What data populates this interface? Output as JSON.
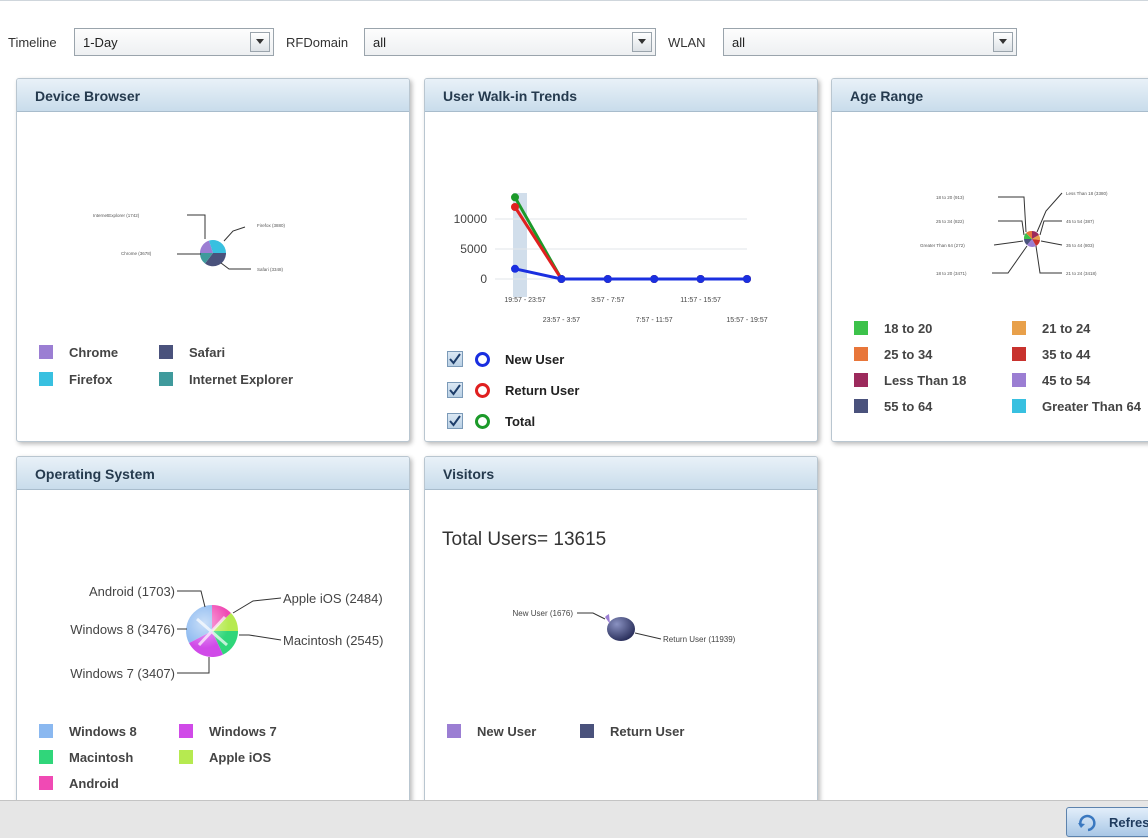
{
  "filters": {
    "timeline": {
      "label": "Timeline",
      "value": "1-Day"
    },
    "rfdomain": {
      "label": "RFDomain",
      "value": "all"
    },
    "wlan": {
      "label": "WLAN",
      "value": "all"
    }
  },
  "panels": {
    "device_browser": {
      "title": "Device Browser",
      "callouts": [
        "InternetExplorer (1742)",
        "Firefox (3880)",
        "Chrome (3678)",
        "Safari (3348)"
      ],
      "legend": [
        {
          "label": "Chrome",
          "color": "#9b7ed3"
        },
        {
          "label": "Safari",
          "color": "#4a527c"
        },
        {
          "label": "Firefox",
          "color": "#38c0e0"
        },
        {
          "label": "Internet Explorer",
          "color": "#3f9a9c"
        }
      ]
    },
    "user_walkin": {
      "title": "User Walk-in Trends",
      "chart_data": {
        "type": "line",
        "x": [
          "19:57 - 23:57",
          "23:57 - 3:57",
          "3:57 - 7:57",
          "7:57 - 11:57",
          "11:57 - 15:57",
          "15:57 - 19:57"
        ],
        "yticks": [
          "10000",
          "5000",
          "0"
        ],
        "ylim": [
          0,
          15000
        ],
        "series": [
          {
            "name": "New User",
            "color": "#1a2fe0",
            "values": [
              1700,
              0,
              0,
              0,
              0,
              0
            ]
          },
          {
            "name": "Return User",
            "color": "#e02020",
            "values": [
              12000,
              0,
              0,
              0,
              0,
              0
            ]
          },
          {
            "name": "Total",
            "color": "#1c9a2a",
            "values": [
              13615,
              0,
              0,
              0,
              0,
              0
            ]
          }
        ]
      },
      "legend": [
        {
          "label": "New User",
          "color": "#1a2fe0",
          "checked": true
        },
        {
          "label": "Return User",
          "color": "#e02020",
          "checked": true
        },
        {
          "label": "Total",
          "color": "#1c9a2a",
          "checked": true
        }
      ]
    },
    "age_range": {
      "title": "Age Range",
      "callouts": [
        "18 to 20 (913)",
        "Less Than 18 (3380)",
        "25 to 34 (822)",
        "45 to 54 (387)",
        "Greater Than 64 (272)",
        "35 to 44 (803)",
        "18 to 20 (3471)",
        "21 to 24 (3418)"
      ],
      "legend": [
        {
          "label": "18 to 20",
          "color": "#3cc24a"
        },
        {
          "label": "21 to 24",
          "color": "#e8a04a"
        },
        {
          "label": "25 to 34",
          "color": "#e8763a"
        },
        {
          "label": "35 to 44",
          "color": "#c8322e"
        },
        {
          "label": "Less Than 18",
          "color": "#9c2a5c"
        },
        {
          "label": "45 to 54",
          "color": "#9b7ed3"
        },
        {
          "label": "55 to 64",
          "color": "#4a527c"
        },
        {
          "label": "Greater Than 64",
          "color": "#38c0e0"
        }
      ]
    },
    "operating_system": {
      "title": "Operating System",
      "callouts": [
        "Android (1703)",
        "Apple iOS (2484)",
        "Windows 8 (3476)",
        "Macintosh (2545)",
        "Windows 7 (3407)"
      ],
      "legend": [
        {
          "label": "Windows 8",
          "color": "#8ab8f0"
        },
        {
          "label": "Windows 7",
          "color": "#d04ae8"
        },
        {
          "label": "Macintosh",
          "color": "#30d67a"
        },
        {
          "label": "Apple iOS",
          "color": "#b6ea50"
        },
        {
          "label": "Android",
          "color": "#f04ab4"
        }
      ]
    },
    "visitors": {
      "title": "Visitors",
      "total": "Total Users= 13615",
      "callouts": [
        "New User (1676)",
        "Return User (11939)"
      ],
      "legend": [
        {
          "label": "New User",
          "color": "#9b7ed3"
        },
        {
          "label": "Return User",
          "color": "#4a527c"
        }
      ]
    }
  },
  "footer": {
    "refresh_label": "Refresh"
  }
}
